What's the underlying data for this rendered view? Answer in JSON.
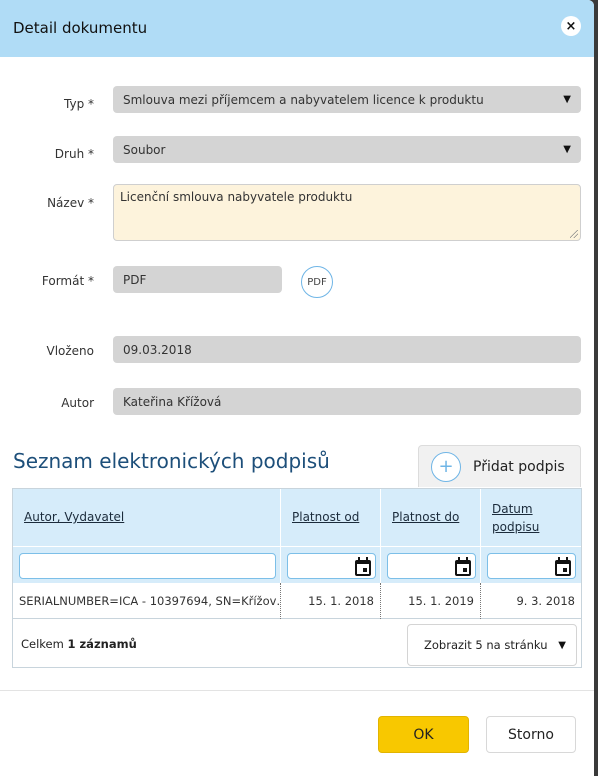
{
  "dialog": {
    "title": "Detail dokumentu",
    "close_icon": "close-icon"
  },
  "form": {
    "typ": {
      "label": "Typ *",
      "value": "Smlouva mezi příjemcem a nabyvatelem licence k produktu",
      "arrow": "▼"
    },
    "druh": {
      "label": "Druh *",
      "value": "Soubor",
      "arrow": "▼"
    },
    "nazev": {
      "label": "Název *",
      "value": "Licenční smlouva nabyvatele produktu"
    },
    "format": {
      "label": "Formát *",
      "value": "PDF",
      "badge": "PDF"
    },
    "vlozeno": {
      "label": "Vloženo",
      "value": "09.03.2018"
    },
    "autor": {
      "label": "Autor",
      "value": "Kateřina Křížová"
    }
  },
  "signatures": {
    "title": "Seznam elektronických podpisů",
    "add_button": {
      "icon": "+",
      "label": "Přidat podpis"
    },
    "columns": [
      {
        "label": "Autor, Vydavatel"
      },
      {
        "label": "Platnost od"
      },
      {
        "label": "Platnost do"
      },
      {
        "label_line1": "Datum",
        "label_line2": "podpisu"
      }
    ],
    "rows": [
      {
        "author": "SERIALNUMBER=ICA - 10397694, SN=Křížov…",
        "valid_from": "15. 1. 2018",
        "valid_to": "15. 1. 2019",
        "signed": "9. 3. 2018"
      }
    ],
    "footer": {
      "total_prefix": "Celkem ",
      "total_bold": "1 záznamů",
      "page_size": "Zobrazit 5 na stránku",
      "arrow": "▼"
    }
  },
  "buttons": {
    "ok": "OK",
    "cancel": "Storno"
  },
  "colors": {
    "header_bg": "#b0dcf6",
    "accent_yellow": "#f8c800",
    "section_title": "#1d4f7a",
    "grid_header_bg": "#d6ecfa",
    "textarea_bg": "#fdf3dc"
  }
}
